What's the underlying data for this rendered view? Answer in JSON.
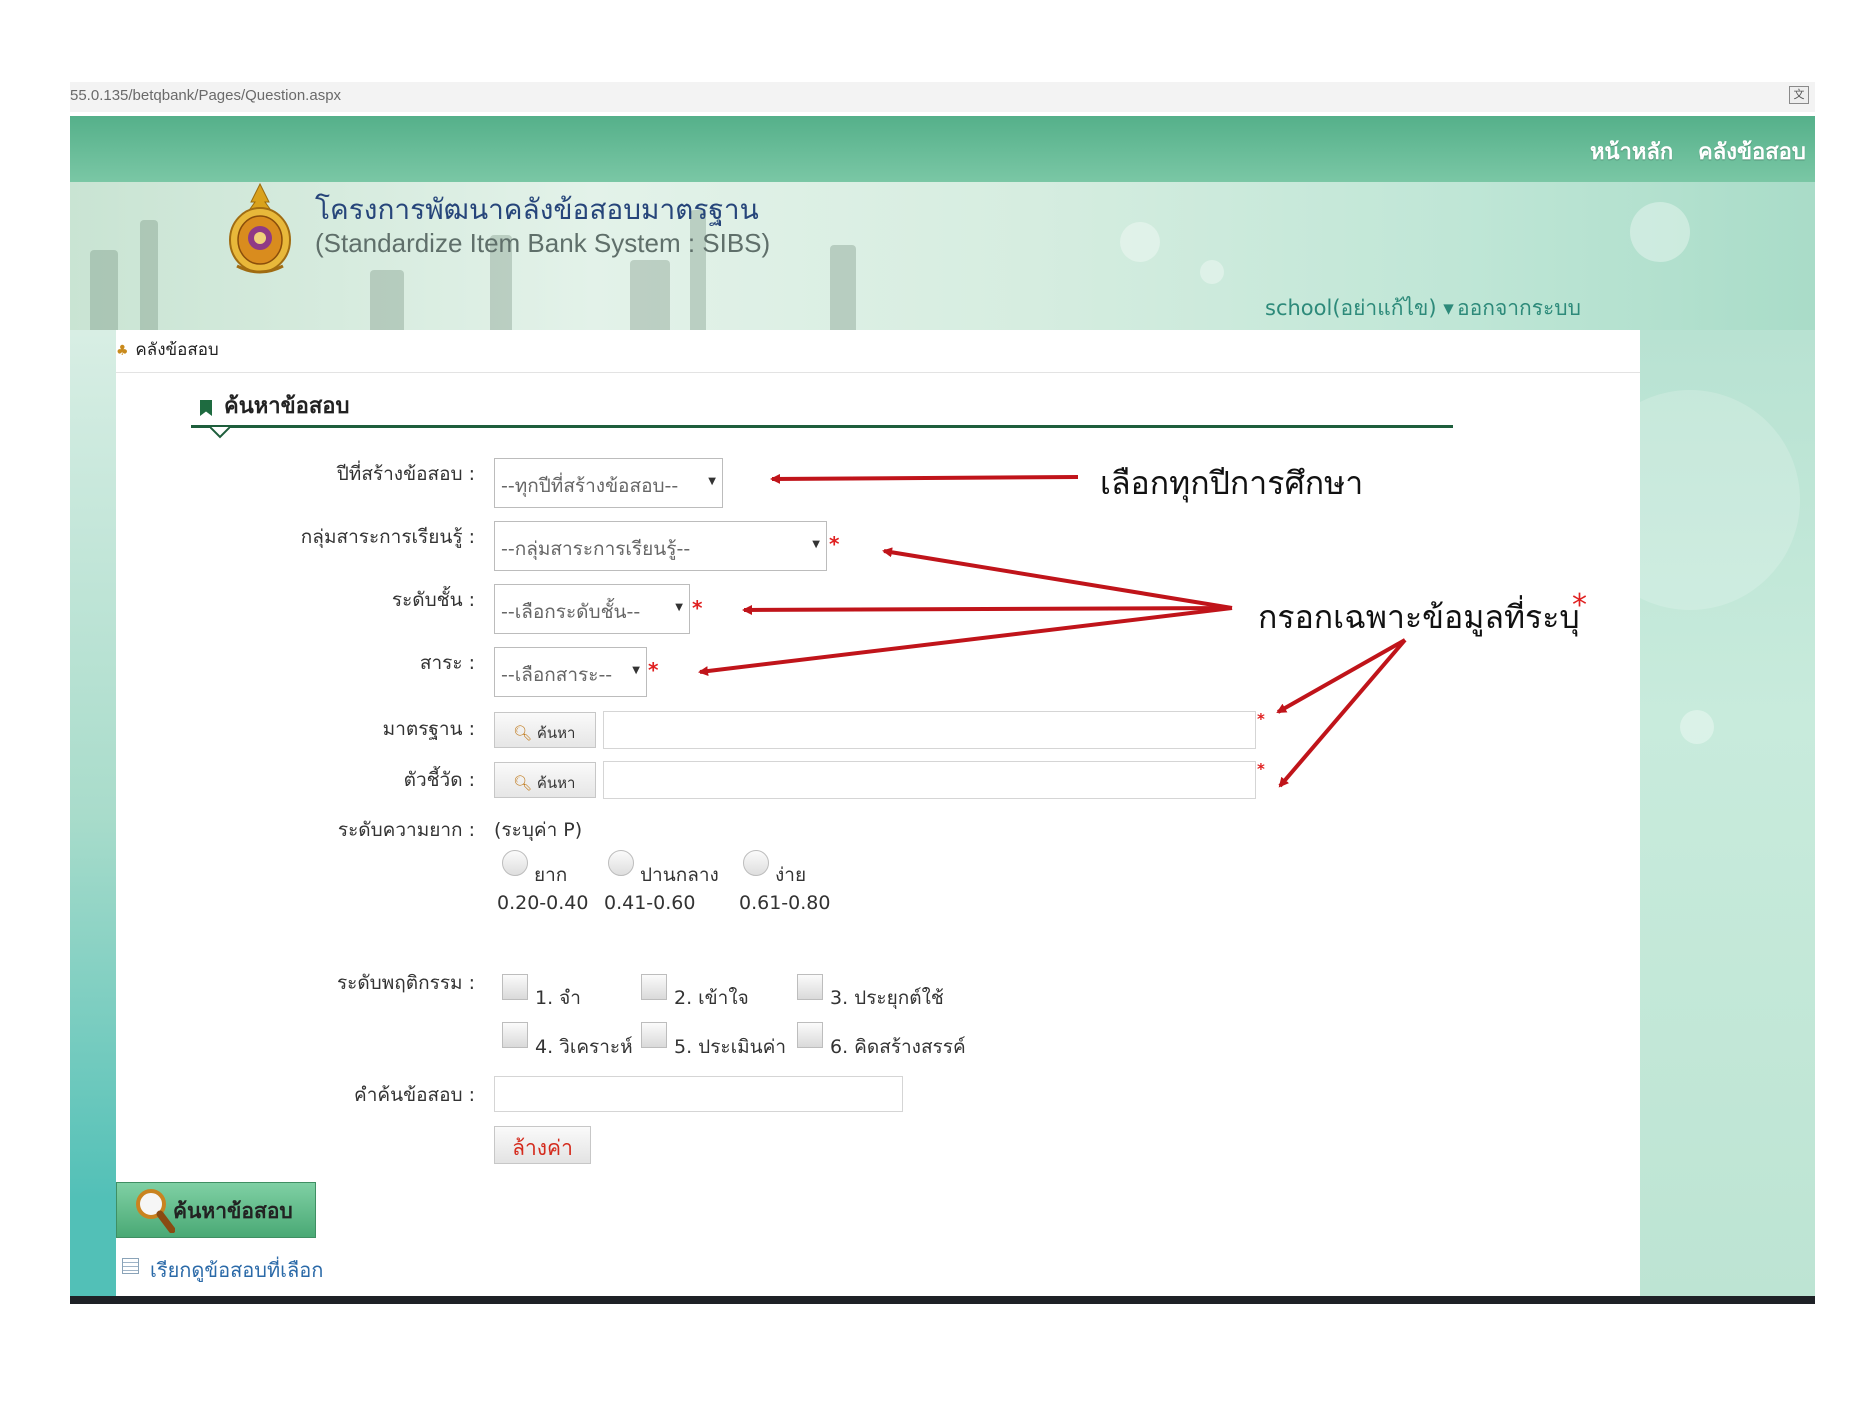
{
  "browser": {
    "url": "55.0.135/betqbank/Pages/Question.aspx"
  },
  "topnav": {
    "home": "หน้าหลัก",
    "item_bank": "คลังข้อสอบ"
  },
  "header": {
    "title_th": "โครงการพัฒนาคลังข้อสอบมาตรฐาน",
    "title_en": "(Standardize Item Bank System : SIBS)",
    "user_menu": "school(อย่าแก้ไข) ▾",
    "logout": "ออกจากระบบ"
  },
  "breadcrumb": "คลังข้อสอบ",
  "section": {
    "title": "ค้นหาข้อสอบ"
  },
  "form": {
    "year_label": "ปีที่สร้างข้อสอบ :",
    "year_value": "--ทุกปีที่สร้างข้อสอบ--",
    "subject_label": "กลุ่มสาระการเรียนรู้ :",
    "subject_value": "--กลุ่มสาระการเรียนรู้--",
    "grade_label": "ระดับชั้น :",
    "grade_value": "--เลือกระดับชั้น--",
    "strand_label": "สาระ :",
    "strand_value": "--เลือกสาระ--",
    "standard_label": "มาตรฐาน :",
    "indicator_label": "ตัวชี้วัด :",
    "search_button": "ค้นหา",
    "required_mark": "*",
    "difficulty_label": "ระดับความยาก :",
    "difficulty_hint": "(ระบุค่า P)",
    "difficulty_options": [
      {
        "label": "ยาก",
        "range": "0.20-0.40"
      },
      {
        "label": "ปานกลาง",
        "range": "0.41-0.60"
      },
      {
        "label": "ง่าย",
        "range": "0.61-0.80"
      }
    ],
    "behavior_label": "ระดับพฤติกรรม :",
    "behavior_options": [
      "1. จำ",
      "2. เข้าใจ",
      "3. ประยุกต์ใช้",
      "4. วิเคราะห์",
      "5. ประเมินค่า",
      "6. คิดสร้างสรรค์"
    ],
    "keyword_label": "คำค้นข้อสอบ :",
    "reset_button": "ล้างค่า"
  },
  "actions": {
    "search_submit": "ค้นหาข้อสอบ",
    "view_selected": "เรียกดูข้อสอบที่เลือก"
  },
  "annotations": {
    "select_all_years": "เลือกทุกปีการศึกษา",
    "fill_required": "กรอกเฉพาะข้อมูลที่ระบุ",
    "required_star": "*",
    "arrow_color": "#c0141a"
  }
}
